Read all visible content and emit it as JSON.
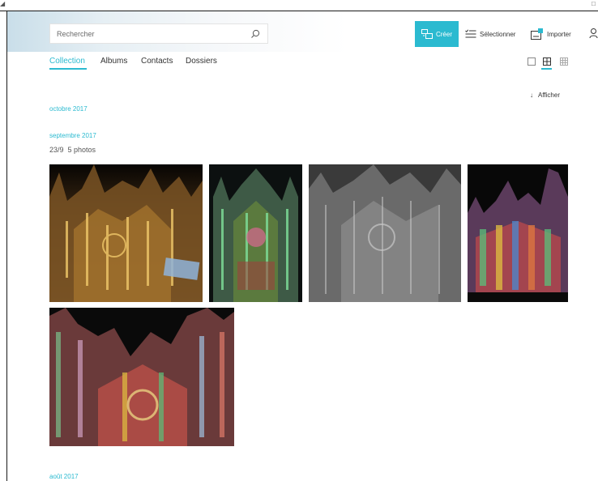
{
  "header": {
    "search": {
      "placeholder": "Rechercher",
      "value": ""
    },
    "create_label": "Créer",
    "select_label": "Sélectionner",
    "import_label": "Importer"
  },
  "tabs": [
    {
      "label": "Collection",
      "active": true
    },
    {
      "label": "Albums",
      "active": false
    },
    {
      "label": "Contacts",
      "active": false
    },
    {
      "label": "Dossiers",
      "active": false
    }
  ],
  "view_options": [
    {
      "icon": "large-view-icon",
      "active": false
    },
    {
      "icon": "medium-view-icon",
      "active": true
    },
    {
      "icon": "small-view-icon",
      "active": false
    }
  ],
  "afficher_label": "Afficher",
  "afficher_icon": "arrow-down-icon",
  "timeline": {
    "months": [
      "octobre 2017",
      "septembre 2017",
      "août 2017"
    ],
    "group": {
      "date": "23/9",
      "count": "5 photos"
    }
  },
  "photos": [
    {
      "subject": "cathedral-night-illumination-gold"
    },
    {
      "subject": "cathedral-night-illumination-green"
    },
    {
      "subject": "cathedral-night-illumination-grey"
    },
    {
      "subject": "cathedral-night-illumination-colors"
    },
    {
      "subject": "cathedral-night-illumination-colors-2"
    }
  ],
  "colors": {
    "accent": "#2bbad0",
    "text": "#333333"
  }
}
